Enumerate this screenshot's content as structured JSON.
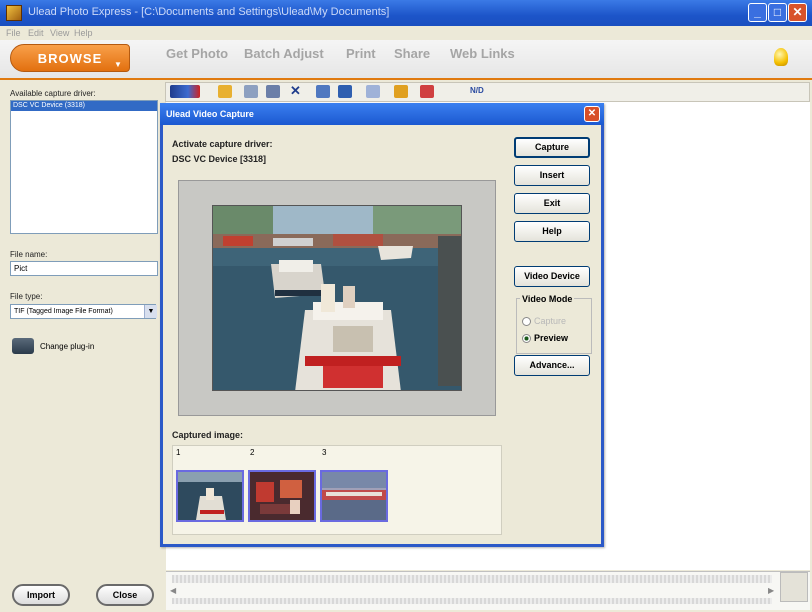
{
  "window": {
    "title": "Ulead Photo Express - [C:\\Documents and Settings\\Ulead\\My Documents]",
    "minimize_glyph": "_",
    "maximize_glyph": "□",
    "close_glyph": "✕"
  },
  "menu": [
    "File",
    "Edit",
    "View",
    "Help"
  ],
  "nav": {
    "browse_label": "BROWSE",
    "links": [
      "Get Photo",
      "Batch Adjust",
      "Print",
      "Share",
      "Web Links"
    ]
  },
  "left_panel": {
    "capture_driver_label": "Available capture driver:",
    "driver_selected": "DSC VC Device (3318)",
    "file_name_label": "File name:",
    "file_name_value": "Pict",
    "file_type_label": "File type:",
    "file_type_value": "TIF (Tagged Image File Format)",
    "plugin_label": "Change plug-in",
    "import_label": "Import",
    "close_label": "Close"
  },
  "toolbar": {
    "icons": [
      "scanner-icon",
      "open-folder-icon",
      "copy-icon",
      "paste-icon",
      "delete-icon",
      "select-icon",
      "thumbnail-icon",
      "view-icon",
      "album-icon",
      "properties-icon"
    ],
    "extra": "N/D"
  },
  "dialog": {
    "title": "Ulead Video Capture",
    "driver_label": "Activate capture driver:",
    "driver_value": "DSC VC Device [3318]",
    "buttons": {
      "capture": "Capture",
      "insert": "Insert",
      "exit": "Exit",
      "help": "Help",
      "video_device": "Video Device",
      "advance": "Advance..."
    },
    "video_mode": {
      "label": "Video Mode",
      "capture_option": "Capture",
      "preview_option": "Preview",
      "selected": "Preview"
    },
    "captured_label": "Captured image:",
    "thumbnails": [
      "1",
      "2",
      "3"
    ]
  },
  "colors": {
    "accent_orange": "#e2700f",
    "title_blue": "#1d55c9",
    "selection_blue": "#316ac5"
  }
}
